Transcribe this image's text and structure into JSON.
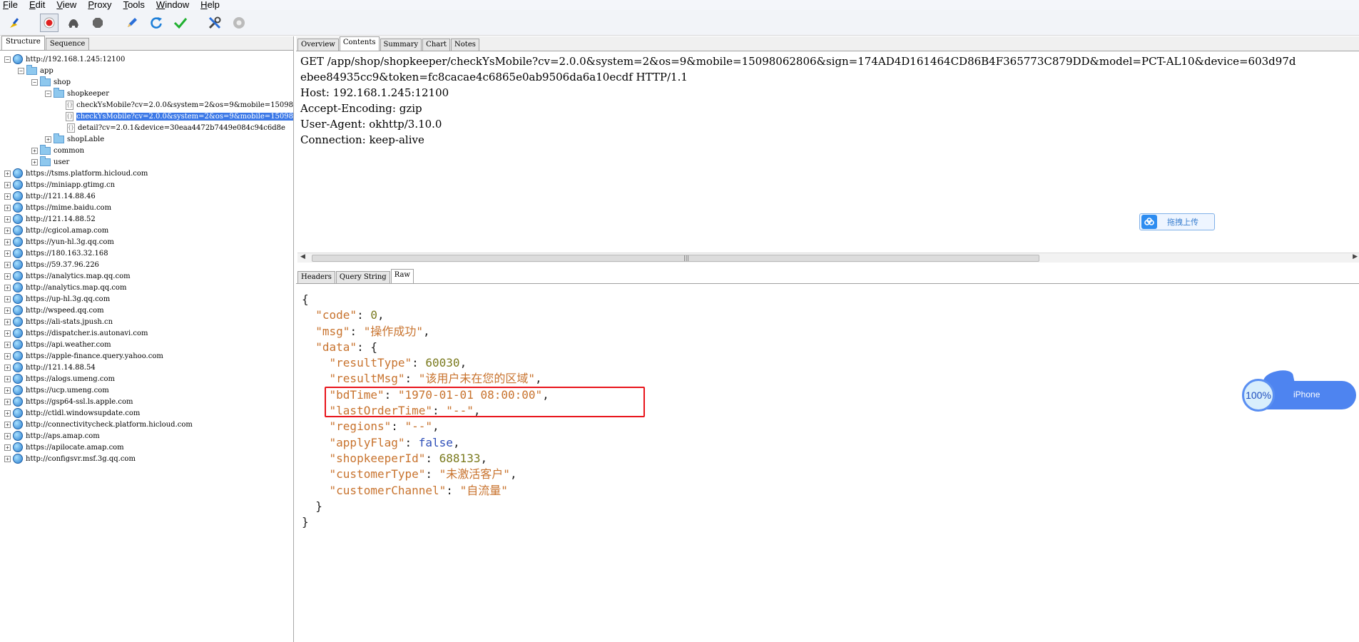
{
  "menu": [
    "File",
    "Edit",
    "View",
    "Proxy",
    "Tools",
    "Window",
    "Help"
  ],
  "menu_underline": [
    "F",
    "E",
    "V",
    "P",
    "T",
    "W",
    "H"
  ],
  "toolbar": {
    "icons": [
      "broom-icon",
      "record-icon",
      "throttle-icon",
      "breakpoint-icon",
      "pen-icon",
      "refresh-icon",
      "check-icon",
      "tools-icon",
      "settings-icon"
    ]
  },
  "left": {
    "tabs": [
      "Structure",
      "Sequence"
    ],
    "tree": [
      {
        "label": "http://192.168.1.245:12100",
        "level": 0,
        "type": "host",
        "expander": "−"
      },
      {
        "label": "app",
        "level": 1,
        "type": "folder",
        "expander": "−"
      },
      {
        "label": "shop",
        "level": 2,
        "type": "folder",
        "expander": "−"
      },
      {
        "label": "shopkeeper",
        "level": 3,
        "type": "folder",
        "expander": "−"
      },
      {
        "label": "checkYsMobile?cv=2.0.0&system=2&os=9&mobile=15098",
        "level": 4,
        "type": "file",
        "expander": ""
      },
      {
        "label": "checkYsMobile?cv=2.0.0&system=2&os=9&mobile=15098",
        "level": 4,
        "type": "file",
        "expander": "",
        "selected": true
      },
      {
        "label": "detail?cv=2.0.1&device=30eaa4472b7449e084c94c6d8e",
        "level": 4,
        "type": "file",
        "expander": ""
      },
      {
        "label": "shopLable",
        "level": 3,
        "type": "folder",
        "expander": "+"
      },
      {
        "label": "common",
        "level": 2,
        "type": "folder",
        "expander": "+"
      },
      {
        "label": "user",
        "level": 2,
        "type": "folder",
        "expander": "+"
      },
      {
        "label": "https://tsms.platform.hicloud.com",
        "level": 0,
        "type": "host",
        "expander": "+"
      },
      {
        "label": "https://miniapp.gtimg.cn",
        "level": 0,
        "type": "host",
        "expander": "+"
      },
      {
        "label": "http://121.14.88.46",
        "level": 0,
        "type": "host",
        "expander": "+"
      },
      {
        "label": "https://mime.baidu.com",
        "level": 0,
        "type": "host",
        "expander": "+"
      },
      {
        "label": "http://121.14.88.52",
        "level": 0,
        "type": "host",
        "expander": "+"
      },
      {
        "label": "http://cgicol.amap.com",
        "level": 0,
        "type": "host",
        "expander": "+"
      },
      {
        "label": "https://yun-hl.3g.qq.com",
        "level": 0,
        "type": "host",
        "expander": "+"
      },
      {
        "label": "https://180.163.32.168",
        "level": 0,
        "type": "host",
        "expander": "+"
      },
      {
        "label": "https://59.37.96.226",
        "level": 0,
        "type": "host",
        "expander": "+"
      },
      {
        "label": "https://analytics.map.qq.com",
        "level": 0,
        "type": "host",
        "expander": "+"
      },
      {
        "label": "http://analytics.map.qq.com",
        "level": 0,
        "type": "host",
        "expander": "+"
      },
      {
        "label": "https://up-hl.3g.qq.com",
        "level": 0,
        "type": "host",
        "expander": "+"
      },
      {
        "label": "http://wspeed.qq.com",
        "level": 0,
        "type": "host",
        "expander": "+"
      },
      {
        "label": "https://ali-stats.jpush.cn",
        "level": 0,
        "type": "host",
        "expander": "+"
      },
      {
        "label": "https://dispatcher.is.autonavi.com",
        "level": 0,
        "type": "host",
        "expander": "+"
      },
      {
        "label": "https://api.weather.com",
        "level": 0,
        "type": "host",
        "expander": "+"
      },
      {
        "label": "https://apple-finance.query.yahoo.com",
        "level": 0,
        "type": "host",
        "expander": "+"
      },
      {
        "label": "http://121.14.88.54",
        "level": 0,
        "type": "host",
        "expander": "+"
      },
      {
        "label": "https://alogs.umeng.com",
        "level": 0,
        "type": "host",
        "expander": "+"
      },
      {
        "label": "https://ucp.umeng.com",
        "level": 0,
        "type": "host",
        "expander": "+"
      },
      {
        "label": "https://gsp64-ssl.ls.apple.com",
        "level": 0,
        "type": "host",
        "expander": "+"
      },
      {
        "label": "http://ctldl.windowsupdate.com",
        "level": 0,
        "type": "host",
        "expander": "+"
      },
      {
        "label": "http://connectivitycheck.platform.hicloud.com",
        "level": 0,
        "type": "host",
        "expander": "+"
      },
      {
        "label": "http://aps.amap.com",
        "level": 0,
        "type": "host",
        "expander": "+"
      },
      {
        "label": "https://apilocate.amap.com",
        "level": 0,
        "type": "host",
        "expander": "+"
      },
      {
        "label": "http://configsvr.msf.3g.qq.com",
        "level": 0,
        "type": "host",
        "expander": "+"
      }
    ]
  },
  "right": {
    "top_tabs": [
      "Overview",
      "Contents",
      "Summary",
      "Chart",
      "Notes"
    ],
    "active_top_tab": "Contents",
    "request_lines": [
      "GET /app/shop/shopkeeper/checkYsMobile?cv=2.0.0&system=2&os=9&mobile=15098062806&sign=174AD4D161464CD86B4F365773C879DD&model=PCT-AL10&device=603d97d",
      "ebee84935cc9&token=fc8cacae4c6865e0ab9506da6a10ecdf HTTP/1.1",
      "Host: 192.168.1.245:12100",
      "Accept-Encoding: gzip",
      "User-Agent: okhttp/3.10.0",
      "Connection: keep-alive"
    ],
    "upload_label": "拖拽上传",
    "bottom_tabs": [
      "Headers",
      "Query String",
      "Raw"
    ],
    "active_bottom_tab": "Raw",
    "response_json": {
      "open": "{",
      "code_key": "\"code\"",
      "code_val": "0",
      "msg_key": "\"msg\"",
      "msg_val": "\"操作成功\"",
      "data_key": "\"data\"",
      "data_open": "{",
      "resultType_key": "\"resultType\"",
      "resultType_val": "60030",
      "resultMsg_key": "\"resultMsg\"",
      "resultMsg_val": "\"该用户未在您的区域\"",
      "bdTime_key": "\"bdTime\"",
      "bdTime_val": "\"1970-01-01 08:00:00\"",
      "lastOrderTime_key": "\"lastOrderTime\"",
      "lastOrderTime_val": "\"--\"",
      "regions_key": "\"regions\"",
      "regions_val": "\"--\"",
      "applyFlag_key": "\"applyFlag\"",
      "applyFlag_val": "false",
      "shopkeeperId_key": "\"shopkeeperId\"",
      "shopkeeperId_val": "688133",
      "customerType_key": "\"customerType\"",
      "customerType_val": "\"未激活客户\"",
      "customerChannel_key": "\"customerChannel\"",
      "customerChannel_val": "\"自流量\"",
      "data_close": "}",
      "close": "}"
    }
  },
  "float_widget": {
    "percent": "100%",
    "label": "iPhone"
  }
}
